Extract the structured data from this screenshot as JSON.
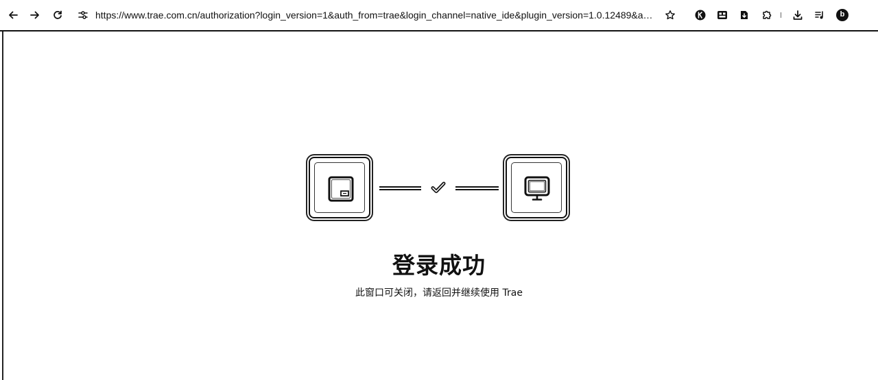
{
  "browser": {
    "url": "https://www.trae.com.cn/authorization?login_version=1&auth_from=trae&login_channel=native_ide&plugin_version=1.0.12489&auth_typ...",
    "nav_icons": [
      "back-arrow-icon",
      "forward-arrow-icon",
      "reload-icon",
      "site-info-icon"
    ],
    "toolbar_icons": [
      "bookmark-star-icon",
      "extension-k-icon",
      "extension-grid-icon",
      "extension-download-square-icon",
      "extensions-puzzle-icon",
      "downloads-icon",
      "media-control-icon",
      "profile-avatar-icon"
    ],
    "profile_initial": "b"
  },
  "page": {
    "title": "登录成功",
    "subtitle": "此窗口可关闭，请返回并继续使用 Trae",
    "left_device_icon": "browser-window-icon",
    "center_icon": "check-icon",
    "right_device_icon": "monitor-icon"
  }
}
